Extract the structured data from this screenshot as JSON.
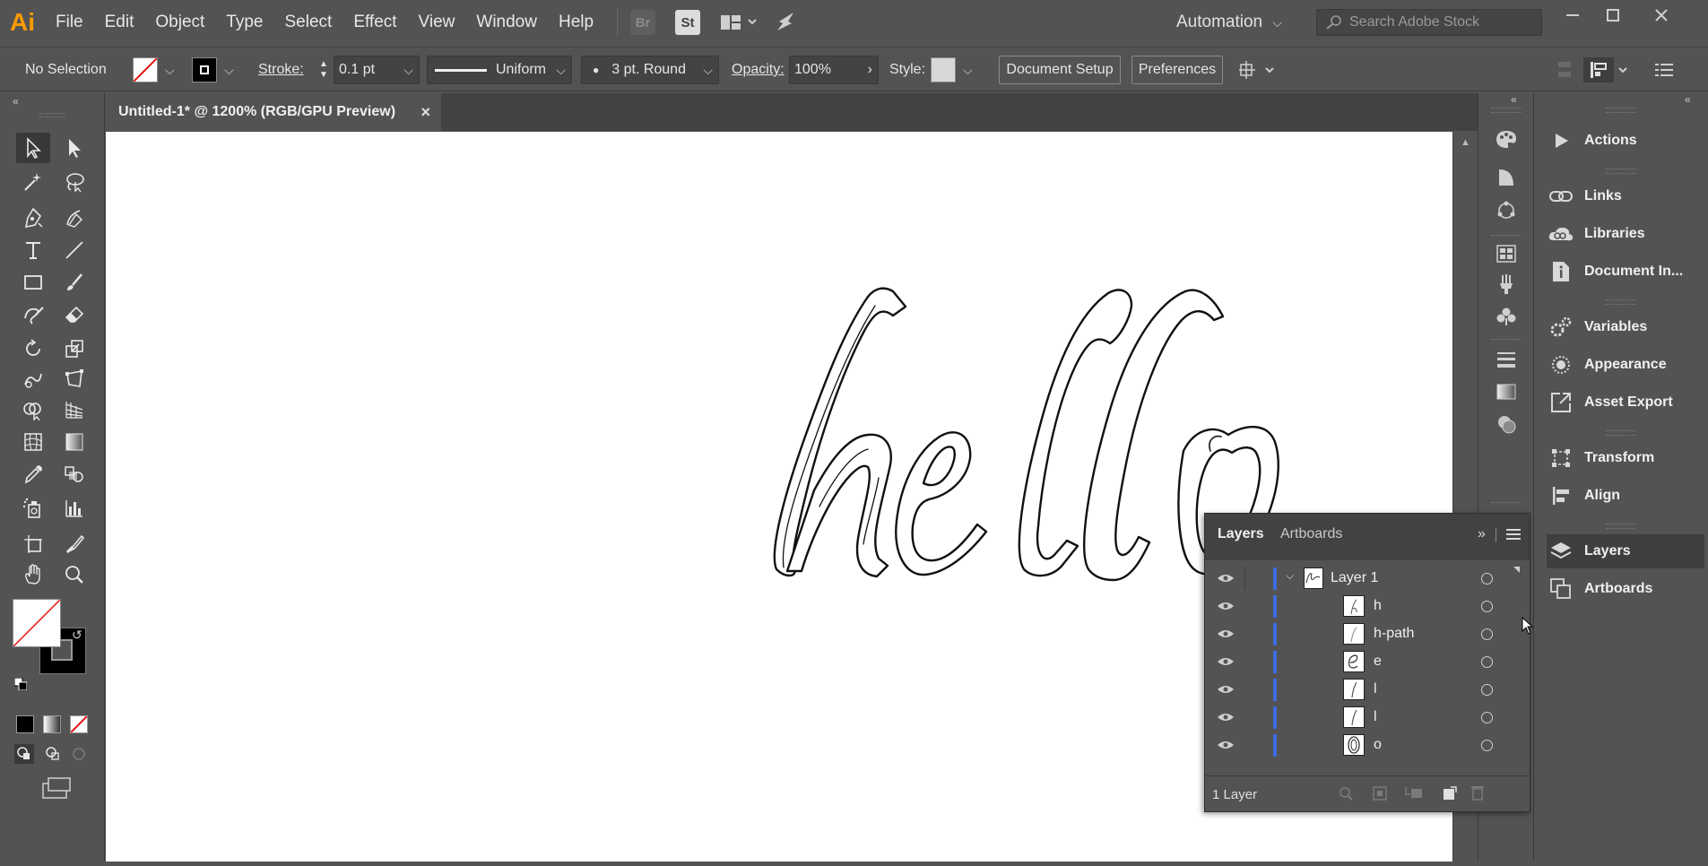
{
  "menubar": {
    "logo": "Ai",
    "items": [
      "File",
      "Edit",
      "Object",
      "Type",
      "Select",
      "Effect",
      "View",
      "Window",
      "Help"
    ],
    "bridge_label": "Br",
    "stock_label": "St",
    "workspace": "Automation",
    "search_placeholder": "Search Adobe Stock"
  },
  "controlbar": {
    "selection": "No Selection",
    "stroke_label": "Stroke:",
    "stroke_value": "0.1 pt",
    "profile": "Uniform",
    "brush": "3 pt. Round",
    "opacity_label": "Opacity:",
    "opacity_value": "100%",
    "style_label": "Style:",
    "document_setup": "Document Setup",
    "preferences": "Preferences"
  },
  "document": {
    "tab_title": "Untitled-1* @ 1200% (RGB/GPU Preview)",
    "close": "×"
  },
  "right_panel": {
    "items": [
      {
        "label": "Actions",
        "icon": "play-icon"
      },
      {
        "label": "Links",
        "icon": "links-icon"
      },
      {
        "label": "Libraries",
        "icon": "cc-libraries-icon"
      },
      {
        "label": "Document In...",
        "icon": "document-info-icon"
      },
      {
        "label": "Variables",
        "icon": "variables-icon"
      },
      {
        "label": "Appearance",
        "icon": "appearance-icon"
      },
      {
        "label": "Asset Export",
        "icon": "asset-export-icon"
      },
      {
        "label": "Transform",
        "icon": "transform-icon"
      },
      {
        "label": "Align",
        "icon": "align-icon"
      },
      {
        "label": "Layers",
        "icon": "layers-icon"
      },
      {
        "label": "Artboards",
        "icon": "artboards-icon"
      }
    ]
  },
  "layers_panel": {
    "tabs": [
      "Layers",
      "Artboards"
    ],
    "parent": "Layer 1",
    "children": [
      "h",
      "h-path",
      "e",
      "l",
      "l",
      "o"
    ],
    "footer": "1 Layer"
  },
  "colors": {
    "ui_bg": "#535353",
    "dark_bg": "#424242",
    "accent_blue": "#3d6de0",
    "ai_orange": "#ff9a00"
  }
}
